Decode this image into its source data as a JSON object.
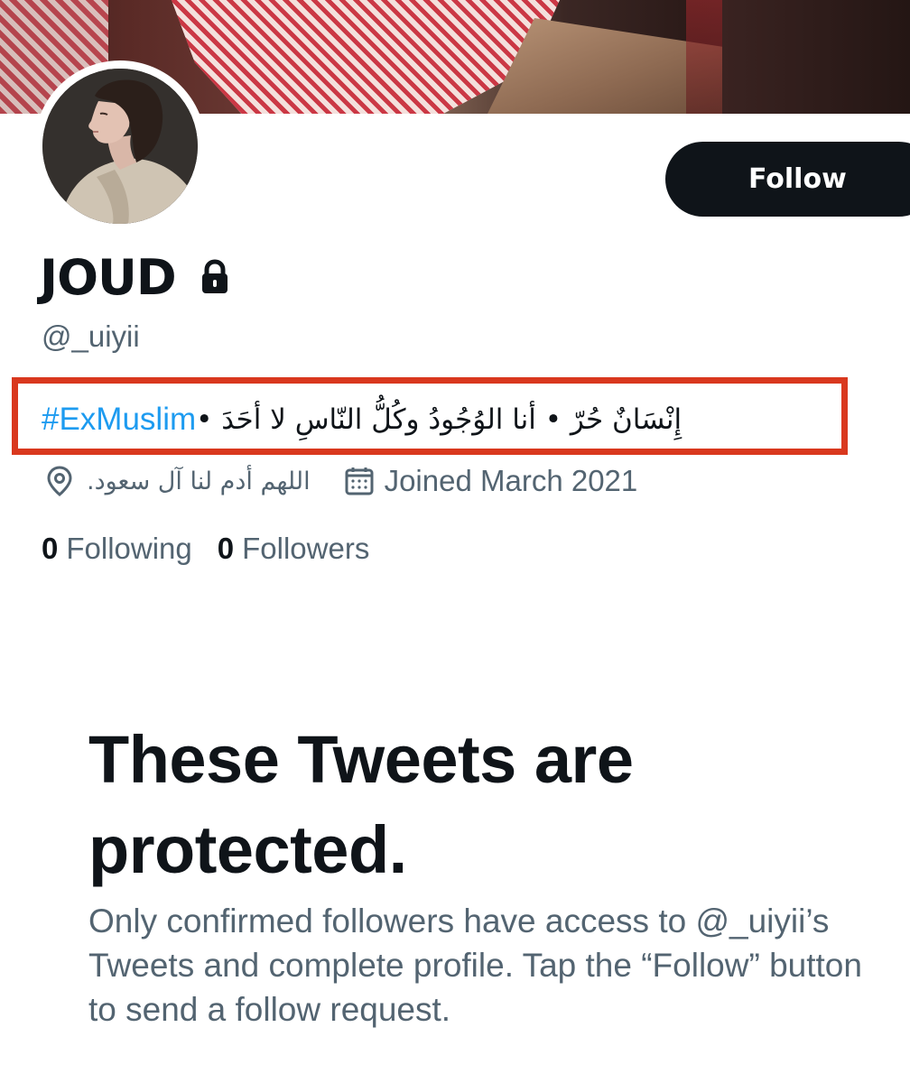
{
  "profile": {
    "display_name": "JOUD",
    "handle": "@_uiyii",
    "bio": {
      "arabic": "إِنْسَانٌ حُرّ • أنا الوُجُودُ وكُلُّ النّاسِ لا أحَدَ •",
      "hashtag": "#ExMuslim"
    },
    "location": "اللهم أدم لنا آل سعود.",
    "joined": "Joined March 2021",
    "following_count": "0",
    "following_label": "Following",
    "followers_count": "0",
    "followers_label": "Followers"
  },
  "actions": {
    "follow_label": "Follow"
  },
  "protected_notice": {
    "title": "These Tweets are protected.",
    "description": "Only confirmed followers have access to @_uiyii’s Tweets and complete profile. Tap the “Follow” button to send a follow request."
  },
  "icons": {
    "lock": "lock-icon",
    "location": "location-pin-icon",
    "calendar": "calendar-icon"
  },
  "colors": {
    "text_primary": "#0f1419",
    "text_secondary": "#536471",
    "link": "#1d9bf0",
    "highlight_border": "#d9381e",
    "button_bg": "#0f1419",
    "button_text": "#ffffff"
  }
}
